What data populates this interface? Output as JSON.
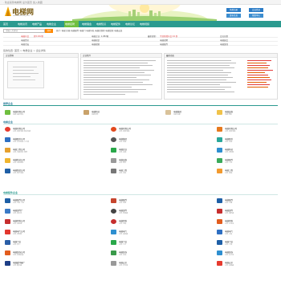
{
  "topbar": {
    "text": "· 欢迎来到电梯网  设为首页  加入收藏"
  },
  "header": {
    "logo_text": "电梯网",
    "logo_sub": "www.diantiwang.com",
    "btn_register": "免费注册",
    "btn_login": "会员登录",
    "btn_publish": "发布信息",
    "btn_help": "帮助中心"
  },
  "nav": {
    "items": [
      "首页",
      "电梯资讯",
      "电梯产品",
      "电梯企业",
      "电梯招聘",
      "电梯展会",
      "电梯知识",
      "电梯配件",
      "电梯论坛",
      "电梯视频"
    ],
    "active_index": 4
  },
  "search": {
    "placeholder": "请输入关键词",
    "button": "搜索",
    "hot": "热门: 电梯 扶梯 电梯配件 电梯门 电梯导轨 电梯控制柜 电梯维保 电梯安装"
  },
  "stats": [
    {
      "a": "电梯产品",
      "a_link": "共5,632条",
      "b": "电梯企业: 1,982家",
      "c": "最新更新:",
      "c_link": "今日新增产品 24 条",
      "d": "会员总数"
    },
    {
      "a": "电梯资讯",
      "b": "电梯知识",
      "c": "电梯招聘",
      "d": "电梯展会"
    },
    {
      "a": "电梯论坛",
      "b": "电梯视频",
      "c": "电梯配件",
      "d": "电梯维保"
    }
  ],
  "breadcrumb": "您的位置: 首页 > 电梯企业 > 企业详情",
  "panels": {
    "left_title": "企业资料",
    "mid_title": "企业简介",
    "right_title": "最新动态"
  },
  "sections": {
    "s1": "推荐企业",
    "s2": "电梯企业",
    "s3": "电梯配件企业"
  },
  "featured": [
    {
      "name": "电梯有限公司",
      "sub": "电梯 扶梯 载货"
    },
    {
      "name": "电梯科技",
      "sub": "电梯 配件"
    },
    {
      "name": "电梯集团",
      "sub": "电梯 扶梯"
    },
    {
      "name": "电梯设备",
      "sub": "电梯 维保"
    }
  ],
  "companies_col1": [
    {
      "name": "电梯有限公司",
      "sub": "主营: 乘客电梯 载货电梯"
    },
    {
      "name": "电梯股份公司",
      "sub": "主营: 自动扶梯 人行道"
    },
    {
      "name": "电梯工程公司",
      "sub": "主营: 电梯安装 维修"
    },
    {
      "name": "电梯科技公司",
      "sub": "主营: 控制系统"
    },
    {
      "name": "电梯制造公司",
      "sub": "主营: 观光电梯"
    }
  ],
  "companies_col2": [
    {
      "name": "电梯有限公司",
      "sub": "主营: 乘客电梯"
    },
    {
      "name": "电梯集团",
      "sub": "主营: 扶梯"
    },
    {
      "name": "电梯实业",
      "sub": "主营: 货梯"
    },
    {
      "name": "电梯设备",
      "sub": "主营: 配件"
    },
    {
      "name": "电梯工程",
      "sub": "主营: 安装"
    }
  ],
  "companies_col3": [
    {
      "name": "电梯有限公司",
      "sub": "主营: 乘客电梯"
    },
    {
      "name": "电梯股份",
      "sub": "主营: 扶梯"
    },
    {
      "name": "电梯科技",
      "sub": "主营: 控制柜"
    },
    {
      "name": "电梯配件",
      "sub": "主营: 门机"
    },
    {
      "name": "电梯工程",
      "sub": "主营: 维保"
    }
  ],
  "parts_col1": [
    {
      "name": "电梯配件公司",
      "sub": "主营: 导轨 门机"
    },
    {
      "name": "电梯部件厂",
      "sub": "主营: 曳引机"
    },
    {
      "name": "电梯材料公司",
      "sub": "主营: 钢丝绳"
    },
    {
      "name": "电梯电气公司",
      "sub": "主营: 控制柜"
    },
    {
      "name": "电梯门业",
      "sub": "主营: 层门"
    },
    {
      "name": "电梯装饰公司",
      "sub": "主营: 轿厢装潢"
    },
    {
      "name": "电梯缓冲器厂",
      "sub": "主营: 缓冲器"
    }
  ],
  "parts_col2": [
    {
      "name": "电梯配件",
      "sub": "主营: 按钮"
    },
    {
      "name": "电梯部件",
      "sub": "主营: 限速器"
    },
    {
      "name": "电梯材料",
      "sub": "主营: 导靴"
    },
    {
      "name": "电梯电气",
      "sub": "主营: 变频器"
    },
    {
      "name": "电梯门业",
      "sub": "主营: 门刀"
    },
    {
      "name": "电梯装饰",
      "sub": "主营: 吊顶"
    },
    {
      "name": "电梯安全",
      "sub": "主营: 安全钳"
    }
  ],
  "parts_col3": [
    {
      "name": "电梯配件",
      "sub": "主营: 光幕"
    },
    {
      "name": "电梯部件",
      "sub": "主营: 编码器"
    },
    {
      "name": "电梯材料",
      "sub": "主营: 对重块"
    },
    {
      "name": "电梯电气",
      "sub": "主营: 主板"
    },
    {
      "name": "电梯门业",
      "sub": "主营: 门锁"
    },
    {
      "name": "电梯装饰",
      "sub": "主营: 扶手带"
    },
    {
      "name": "电梯安全",
      "sub": "主营: 夹绳器"
    }
  ],
  "colors": {
    "nav": "#2b9a8f",
    "nav_active": "#6fbf3f",
    "search_btn": "#ff8800",
    "link_red": "#e23b3b",
    "link_orange": "#e25d00"
  }
}
